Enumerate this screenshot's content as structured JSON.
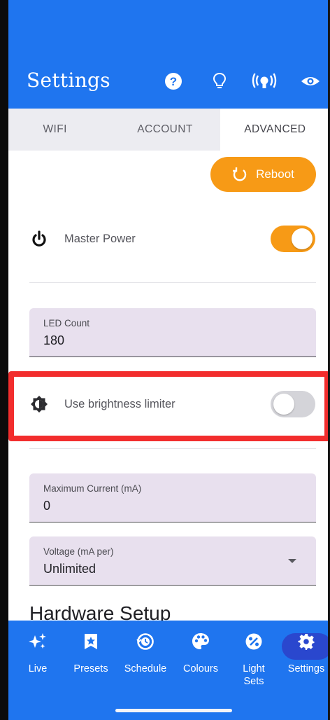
{
  "appbar": {
    "title": "Settings",
    "icons": [
      "help-icon",
      "bulb-icon",
      "broadcast-icon",
      "eye-icon"
    ],
    "color": "#1f75ef"
  },
  "tabs": [
    {
      "label": "WIFI",
      "active": false
    },
    {
      "label": "ACCOUNT",
      "active": false
    },
    {
      "label": "ADVANCED",
      "active": true
    }
  ],
  "reboot": {
    "label": "Reboot",
    "color": "#f79a16"
  },
  "master_power": {
    "label": "Master Power",
    "on": true
  },
  "led_count": {
    "label": "LED Count",
    "value": "180"
  },
  "brightness_limiter": {
    "label": "Use brightness limiter",
    "on": false
  },
  "max_current": {
    "label": "Maximum Current (mA)",
    "value": "0"
  },
  "voltage": {
    "label": "Voltage (mA per)",
    "value": "Unlimited"
  },
  "section_heading": "Hardware Setup",
  "bottom_nav": [
    {
      "label": "Live",
      "icon": "sparkle-icon",
      "active": false
    },
    {
      "label": "Presets",
      "icon": "star-bookmark-icon",
      "active": false
    },
    {
      "label": "Schedule",
      "icon": "clock-icon",
      "active": false
    },
    {
      "label": "Colours",
      "icon": "palette-icon",
      "active": false
    },
    {
      "label": "Light Sets",
      "icon": "light-sets-icon",
      "active": false
    },
    {
      "label": "Settings",
      "icon": "gear-icon",
      "active": true
    }
  ],
  "colors": {
    "accent": "#f79a16",
    "primary": "#1f75ef",
    "nav_active": "#2a47ce",
    "highlight": "#f22d2d"
  }
}
